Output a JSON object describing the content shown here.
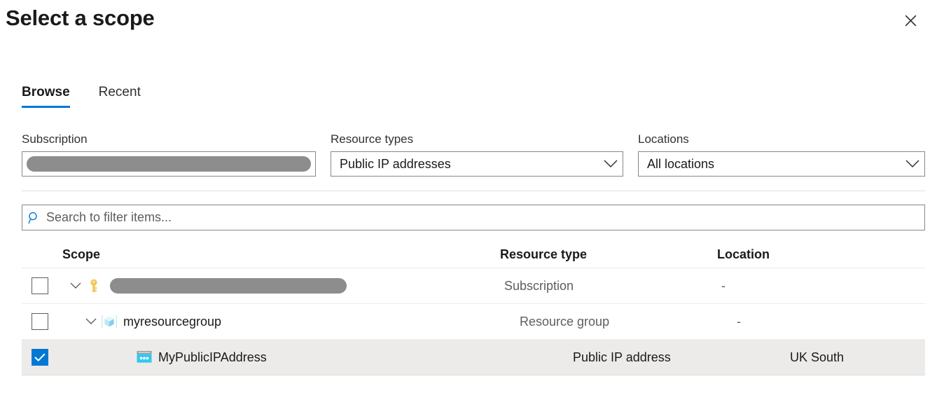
{
  "header": {
    "title": "Select a scope",
    "close_label": "Close"
  },
  "tabs": [
    {
      "label": "Browse",
      "active": true
    },
    {
      "label": "Recent",
      "active": false
    }
  ],
  "filters": {
    "subscription": {
      "label": "Subscription",
      "value": "",
      "redacted": true
    },
    "resource_types": {
      "label": "Resource types",
      "value": "Public IP addresses"
    },
    "locations": {
      "label": "Locations",
      "value": "All locations"
    }
  },
  "search": {
    "placeholder": "Search to filter items...",
    "value": ""
  },
  "table": {
    "columns": {
      "scope": "Scope",
      "resource_type": "Resource type",
      "location": "Location"
    },
    "rows": [
      {
        "name": "",
        "redacted": true,
        "icon": "key-icon",
        "resource_type": "Subscription",
        "location": "-",
        "checked": false,
        "expandable": true,
        "selected": false,
        "indent": 1
      },
      {
        "name": "myresourcegroup",
        "redacted": false,
        "icon": "resource-group-icon",
        "resource_type": "Resource group",
        "location": "-",
        "checked": false,
        "expandable": true,
        "selected": false,
        "indent": 2
      },
      {
        "name": "MyPublicIPAddress",
        "redacted": false,
        "icon": "public-ip-address-icon",
        "resource_type": "Public IP address",
        "location": "UK South",
        "checked": true,
        "expandable": false,
        "selected": true,
        "indent": 3
      }
    ]
  },
  "colors": {
    "accent": "#0078d4",
    "selected_row": "#edebe9",
    "border": "#8a8886",
    "muted_text": "#605e5c",
    "redaction": "#8d8d8d"
  }
}
